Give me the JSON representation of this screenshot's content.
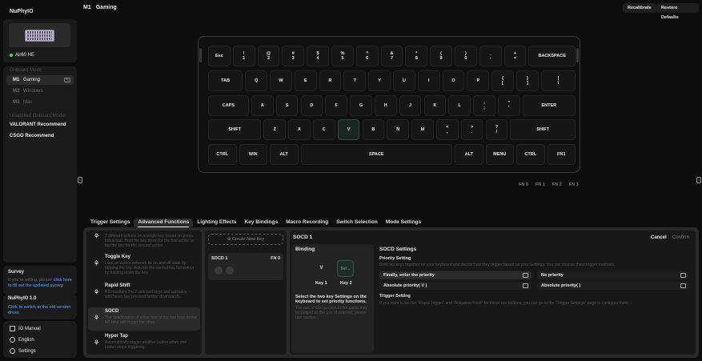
{
  "app": {
    "brand": "NuPhyIO",
    "device_name": "Air60 HE",
    "status_color": "#4cd964",
    "accent_link_color": "#5aa7ff"
  },
  "sidebar": {
    "onboard_label": "Onboard Mode",
    "modes": [
      {
        "code": "M1",
        "name": "Gaming"
      },
      {
        "code": "M2",
        "name": "Windows"
      },
      {
        "code": "M3",
        "name": "Mac"
      }
    ],
    "unapplied_label": "Unapplied Onboard Mode",
    "recommends": [
      "VALORANT Recommend",
      "CSGO Recommend"
    ],
    "survey_title": "Survey",
    "survey_text": "If you're willing, please ",
    "survey_link": "click here to fill out the updated survey",
    "nuphy_title": "NuPhyIO 1.0",
    "nuphy_link": "Click to switch to the old version driver.",
    "footer": {
      "manual": "IO Manual",
      "language": "English",
      "settings": "Settings"
    }
  },
  "topbar": {
    "profile_code": "M1",
    "profile_name": "Gaming",
    "recalibrate": "Recalibrate",
    "restore": "Restore Defaults"
  },
  "keyboard": {
    "rows": [
      [
        {
          "t": "Esc"
        },
        {
          "t": "!",
          "b": "1"
        },
        {
          "t": "@",
          "b": "2"
        },
        {
          "t": "#",
          "b": "3"
        },
        {
          "t": "$",
          "b": "4"
        },
        {
          "t": "%",
          "b": "5"
        },
        {
          "t": "^",
          "b": "6"
        },
        {
          "t": "&",
          "b": "7"
        },
        {
          "t": "*",
          "b": "8"
        },
        {
          "t": "(",
          "b": "9"
        },
        {
          "t": ")",
          "b": "0"
        },
        {
          "t": "_",
          "b": "-"
        },
        {
          "t": "+",
          "b": "="
        },
        {
          "t": "BACKSPACE"
        }
      ],
      [
        {
          "t": "TAB"
        },
        {
          "t": "Q"
        },
        {
          "t": "W"
        },
        {
          "t": "E"
        },
        {
          "t": "R"
        },
        {
          "t": "T"
        },
        {
          "t": "Y"
        },
        {
          "t": "U"
        },
        {
          "t": "I"
        },
        {
          "t": "O"
        },
        {
          "t": "P"
        },
        {
          "t": "{",
          "b": "["
        },
        {
          "t": "}",
          "b": "]"
        },
        {
          "t": "|",
          "b": "\\"
        }
      ],
      [
        {
          "t": "CAPS"
        },
        {
          "t": "A"
        },
        {
          "t": "S"
        },
        {
          "t": "D"
        },
        {
          "t": "F"
        },
        {
          "t": "G"
        },
        {
          "t": "H"
        },
        {
          "t": "J"
        },
        {
          "t": "K"
        },
        {
          "t": "L"
        },
        {
          "t": ":",
          "b": ";"
        },
        {
          "t": "\"",
          "b": "'"
        },
        {
          "t": "ENTER"
        }
      ],
      [
        {
          "t": "SHIFT"
        },
        {
          "t": "Z"
        },
        {
          "t": "X"
        },
        {
          "t": "C"
        },
        {
          "t": "V",
          "selected": true
        },
        {
          "t": "B"
        },
        {
          "t": "N"
        },
        {
          "t": "M"
        },
        {
          "t": "<",
          "b": ","
        },
        {
          "t": ">",
          "b": "."
        },
        {
          "t": "?",
          "b": "/"
        },
        {
          "t": "SHIFT"
        }
      ],
      [
        {
          "t": "CTRL"
        },
        {
          "t": "WIN"
        },
        {
          "t": "ALT"
        },
        {
          "t": "SPACE"
        },
        {
          "t": "ALT"
        },
        {
          "t": "MENU"
        },
        {
          "t": "CTRL"
        },
        {
          "t": "FN1"
        }
      ]
    ],
    "fn_layers": [
      "FN 0",
      "FN 1",
      "FN 2",
      "FN 3"
    ]
  },
  "tabs": [
    "Trigger Settings",
    "Advanced Functions",
    "Lighting Effects",
    "Key Bindings",
    "Macro Recording",
    "Switch Selection",
    "Mode Settings"
  ],
  "functions": [
    {
      "name": "",
      "desc": "2 different actions on a single key based on press behaviour. Hold the key down for the first action or tap the key for the second action."
    },
    {
      "name": "Toggle Key",
      "desc": "Lock an action between its on and off state by tapping the key. Activate the normal key behaviour by holding down the key."
    },
    {
      "name": "Rapid Shift",
      "desc": "RS monitors the 2 selected keys and activates whichever key pressed further downwards."
    },
    {
      "name": "SOCD",
      "desc": "The deactivation of either one of the two keys in the NT bind will trigger the other."
    },
    {
      "name": "Hyper Tap",
      "desc": "Automatically trigger another button when one button stops triggering."
    }
  ],
  "socd_list": {
    "create_label": "Create New Key",
    "card_name": "SOCD  1",
    "card_layer": "FN 0"
  },
  "detail": {
    "title": "SOCD 1",
    "cancel": "Cancel",
    "confirm": "Confirm",
    "binding_title": "Binding",
    "key1_value": "V",
    "key2_value": "Sel...",
    "key1_label": "Key 1",
    "key2_label": "Key 2",
    "instruction": "Select the two key Settings on the keyboard to set priority functions.",
    "note": "The use of this function in the game may be judged as the use of external, please use caution.",
    "settings_title": "SOCD Settings",
    "priority_title": "Priority Setting",
    "priority_desc": "Bind two keys together on your keyboard and decide how they trigger based on your Settings. You can choose three trigger methods.",
    "options": [
      {
        "label": "Finally, enter the priority",
        "selected": true
      },
      {
        "label": "No priority",
        "selected": false
      },
      {
        "label": "Absolute priority( V )",
        "selected": false
      },
      {
        "label": "Absolute priority( )",
        "selected": false
      }
    ],
    "trigger_title": "Trigger Setting",
    "trigger_desc": "If you want to set the \"Rapid Trigger\" and \"Actuation Point\" for these two buttons, you can go to the \"Trigger Settings\" page to configure them."
  }
}
